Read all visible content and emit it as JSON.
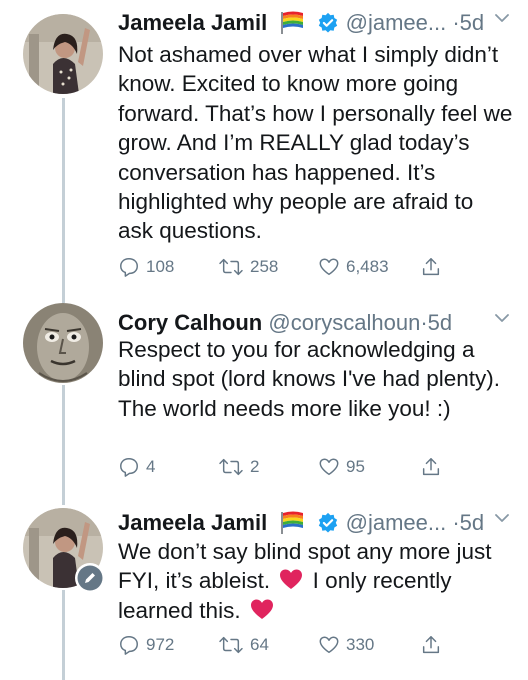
{
  "tweets": [
    {
      "name": "Jameela Jamil",
      "handle": "@jamee...",
      "sep": "·",
      "time": "5d",
      "text": "Not ashamed over what I simply didn’t know. Excited to know more going forward. That’s how I personally feel we grow. And I’m REALLY glad today’s conversation has happened. It’s highlighted why people are afraid to ask questions.",
      "replies": "108",
      "retweets": "258",
      "likes": "6,483"
    },
    {
      "name": "Cory Calhoun",
      "handle": "@coryscalhoun",
      "sep": "·",
      "time": "5d",
      "text": "Respect to you for acknowledging a blind spot (lord knows I've had plenty). The world needs more like you! :)",
      "replies": "4",
      "retweets": "2",
      "likes": "95"
    },
    {
      "name": "Jameela Jamil",
      "handle": "@jamee...",
      "sep": "·",
      "time": "5d",
      "text_part1": "We don’t say blind spot any more just FYI, it’s ableist.",
      "text_part2": "I only recently learned this.",
      "replies": "972",
      "retweets": "64",
      "likes": "330"
    }
  ],
  "colors": {
    "text": "#14171a",
    "muted": "#657786",
    "verified": "#1da1f2",
    "thread_line": "#c4cfd6",
    "heart": "#e0245e"
  }
}
